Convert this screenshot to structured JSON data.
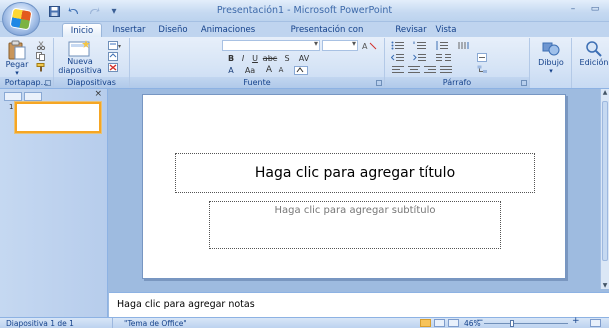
{
  "window": {
    "title": "Presentación1 - Microsoft PowerPoint",
    "qat": [
      "save-icon",
      "undo-icon",
      "redo-icon",
      "qat-dropdown-icon"
    ]
  },
  "tabs": [
    {
      "label": "Inicio",
      "active": true
    },
    {
      "label": "Insertar"
    },
    {
      "label": "Diseño"
    },
    {
      "label": "Animaciones"
    },
    {
      "label": "Presentación con diapositivas"
    },
    {
      "label": "Revisar"
    },
    {
      "label": "Vista"
    }
  ],
  "ribbon": {
    "clipboard": {
      "paste_label": "Pegar",
      "group_label": "Portapap...",
      "launcher": "⊡"
    },
    "slides": {
      "new_slide_label": "Nueva",
      "new_slide_label2": "diapositiva ▾",
      "group_label": "Diapositivas"
    },
    "font": {
      "bold": "B",
      "italic": "I",
      "underline": "U",
      "strike": "abc",
      "shadow": "S",
      "spacing": "AV",
      "case": "Aa",
      "grow": "A",
      "shrink": "A",
      "group_label": "Fuente"
    },
    "paragraph": {
      "group_label": "Párrafo"
    },
    "drawing": {
      "label": "Dibujo"
    },
    "editing": {
      "label": "Edición"
    }
  },
  "leftpane": {
    "thumb_number": "1",
    "close": "×"
  },
  "slide": {
    "title_placeholder": "Haga clic para agregar título",
    "subtitle_placeholder": "Haga clic para agregar subtítulo"
  },
  "notes": {
    "placeholder": "Haga clic para agregar notas"
  },
  "status": {
    "slide_info": "Diapositiva 1 de 1",
    "theme": "\"Tema de Office\"",
    "zoom": "46%",
    "zoom_out": "−",
    "zoom_in": "+"
  },
  "colors": {
    "accent": "#15428b",
    "ribbon": "#d6e4f6",
    "selected_thumb": "#f6a623"
  }
}
